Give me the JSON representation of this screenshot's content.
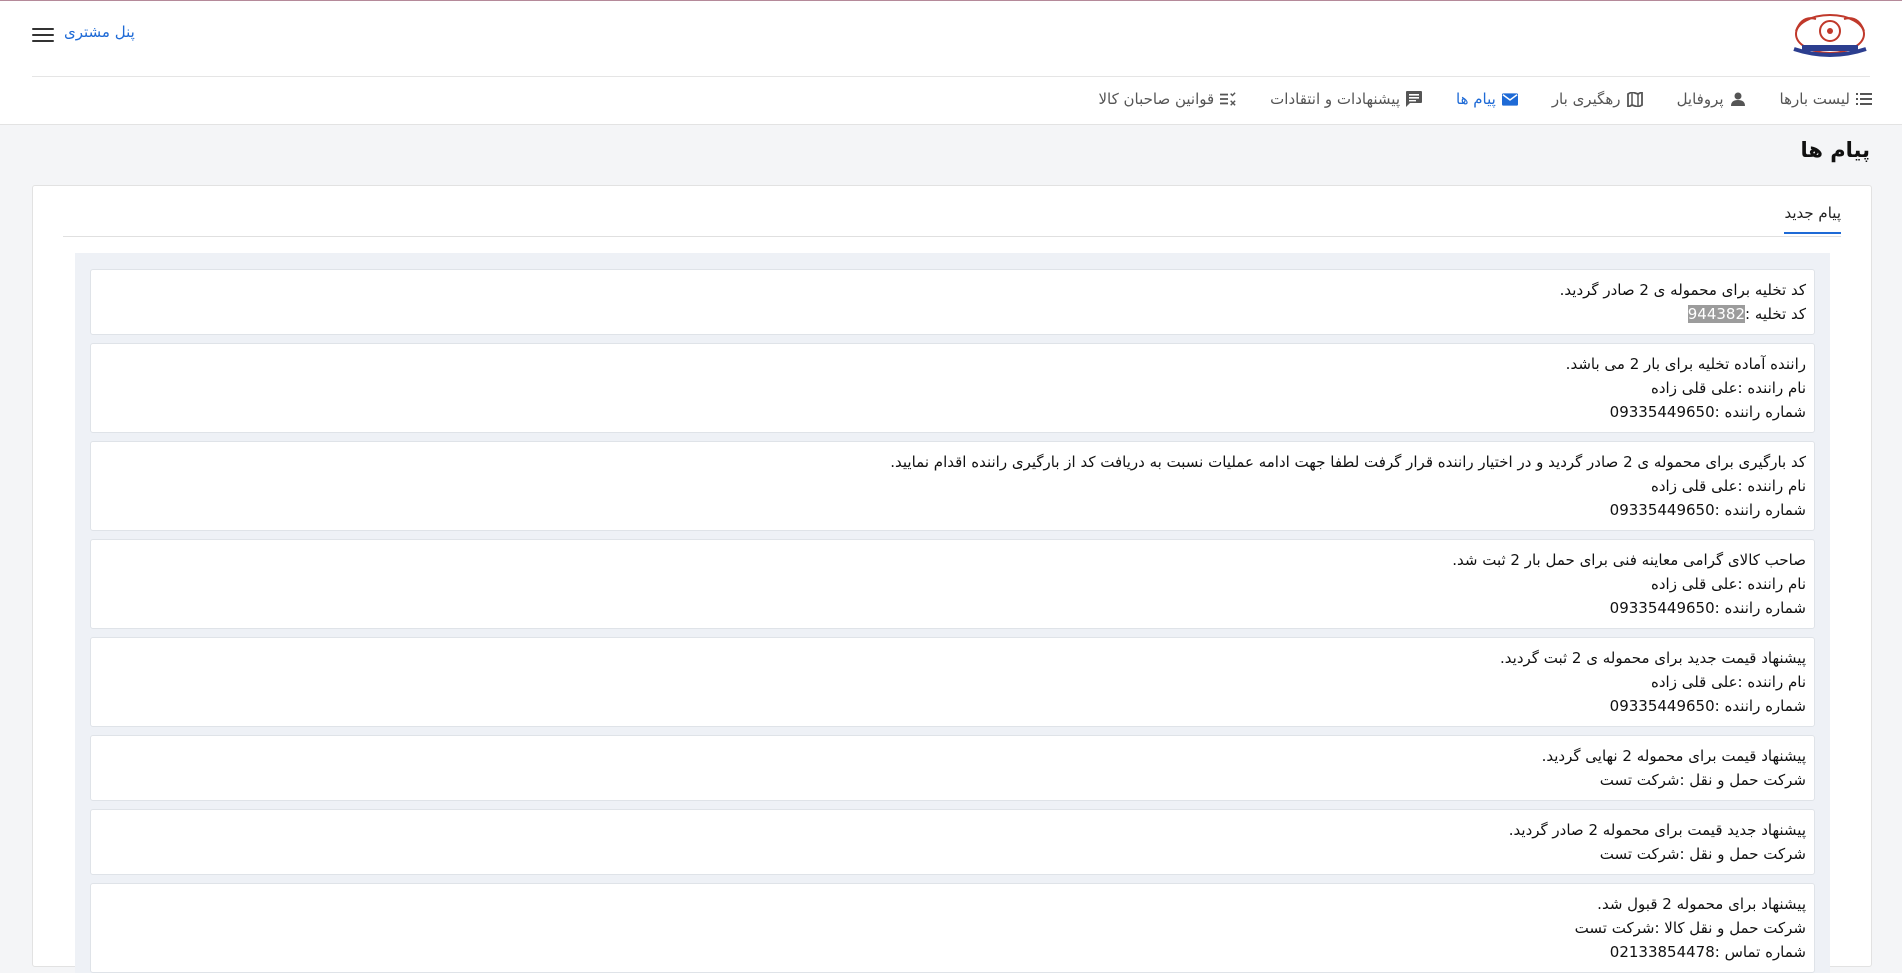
{
  "header": {
    "panel_label": "پنل مشتری",
    "logo_icon": "truck-emblem-logo",
    "menu_icon": "hamburger-menu-icon"
  },
  "nav": {
    "items": [
      {
        "label": "لیست بارها",
        "icon": "list-icon"
      },
      {
        "label": "پروفایل",
        "icon": "person-icon"
      },
      {
        "label": "رهگیری بار",
        "icon": "map-icon"
      },
      {
        "label": "پیام ها",
        "icon": "mail-icon",
        "active": true
      },
      {
        "label": "پیشنهادات و انتقادات",
        "icon": "comment-icon"
      },
      {
        "label": "قوانین صاحبان کالا",
        "icon": "rules-checklist-icon"
      }
    ]
  },
  "page": {
    "title": "پیام ها",
    "tab_new": "پیام جدید"
  },
  "colors": {
    "accent": "#1e6ad6",
    "highlight": "#9c9c9c"
  },
  "messages": [
    {
      "lines": [
        "کد تخلیه برای محموله ی 2 صادر گردید.",
        "کد تخلیه :"
      ],
      "code": "944382"
    },
    {
      "lines": [
        "راننده آماده تخلیه برای بار 2 می باشد.",
        "نام راننده :علی قلی زاده",
        "شماره راننده :09335449650"
      ]
    },
    {
      "lines": [
        "کد بارگیری برای محموله ی 2 صادر گردید و در اختیار راننده قرار گرفت لطفا جهت ادامه عملیات نسبت به دریافت کد از بارگیری راننده اقدام نمایید.",
        "نام راننده :علی قلی زاده",
        "شماره راننده :09335449650"
      ]
    },
    {
      "lines": [
        "صاحب کالای گرامی معاینه فنی برای حمل بار 2 ثبت شد.",
        "نام راننده :علی قلی زاده",
        "شماره راننده :09335449650"
      ]
    },
    {
      "lines": [
        "پیشنهاد  قیمت جدید برای محموله ی 2 ثبت گردید.",
        "نام راننده :علی قلی زاده",
        "شماره راننده :09335449650"
      ]
    },
    {
      "lines": [
        "پیشنهاد قیمت برای محموله 2 نهایی گردید.",
        "شرکت حمل و نقل :شرکت تست"
      ]
    },
    {
      "lines": [
        "پیشنهاد جدید قیمت برای محموله 2 صادر گردید.",
        "شرکت حمل و نقل :شرکت تست"
      ]
    },
    {
      "lines": [
        "پیشنهاد برای محموله 2 قبول شد.",
        "شرکت حمل و نقل کالا  :شرکت تست",
        "شماره تماس :02133854478"
      ]
    }
  ]
}
